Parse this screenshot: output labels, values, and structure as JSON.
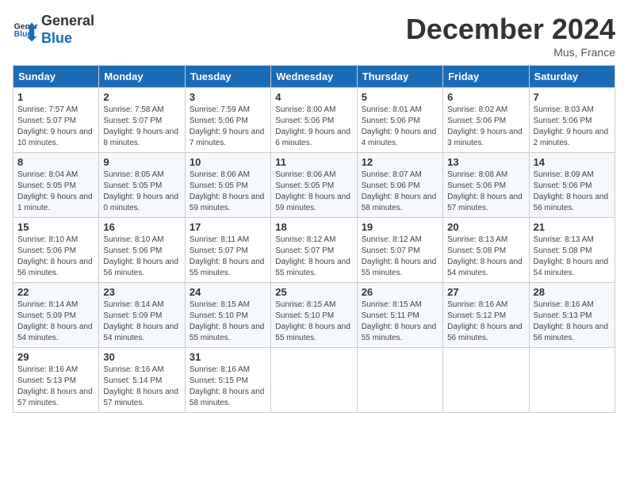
{
  "logo": {
    "line1": "General",
    "line2": "Blue"
  },
  "title": "December 2024",
  "subtitle": "Mus, France",
  "days_header": [
    "Sunday",
    "Monday",
    "Tuesday",
    "Wednesday",
    "Thursday",
    "Friday",
    "Saturday"
  ],
  "weeks": [
    [
      {
        "day": "1",
        "sunrise": "7:57 AM",
        "sunset": "5:07 PM",
        "daylight": "9 hours and 10 minutes."
      },
      {
        "day": "2",
        "sunrise": "7:58 AM",
        "sunset": "5:07 PM",
        "daylight": "9 hours and 8 minutes."
      },
      {
        "day": "3",
        "sunrise": "7:59 AM",
        "sunset": "5:06 PM",
        "daylight": "9 hours and 7 minutes."
      },
      {
        "day": "4",
        "sunrise": "8:00 AM",
        "sunset": "5:06 PM",
        "daylight": "9 hours and 6 minutes."
      },
      {
        "day": "5",
        "sunrise": "8:01 AM",
        "sunset": "5:06 PM",
        "daylight": "9 hours and 4 minutes."
      },
      {
        "day": "6",
        "sunrise": "8:02 AM",
        "sunset": "5:06 PM",
        "daylight": "9 hours and 3 minutes."
      },
      {
        "day": "7",
        "sunrise": "8:03 AM",
        "sunset": "5:06 PM",
        "daylight": "9 hours and 2 minutes."
      }
    ],
    [
      {
        "day": "8",
        "sunrise": "8:04 AM",
        "sunset": "5:05 PM",
        "daylight": "9 hours and 1 minute."
      },
      {
        "day": "9",
        "sunrise": "8:05 AM",
        "sunset": "5:05 PM",
        "daylight": "9 hours and 0 minutes."
      },
      {
        "day": "10",
        "sunrise": "8:06 AM",
        "sunset": "5:05 PM",
        "daylight": "8 hours and 59 minutes."
      },
      {
        "day": "11",
        "sunrise": "8:06 AM",
        "sunset": "5:05 PM",
        "daylight": "8 hours and 59 minutes."
      },
      {
        "day": "12",
        "sunrise": "8:07 AM",
        "sunset": "5:06 PM",
        "daylight": "8 hours and 58 minutes."
      },
      {
        "day": "13",
        "sunrise": "8:08 AM",
        "sunset": "5:06 PM",
        "daylight": "8 hours and 57 minutes."
      },
      {
        "day": "14",
        "sunrise": "8:09 AM",
        "sunset": "5:06 PM",
        "daylight": "8 hours and 56 minutes."
      }
    ],
    [
      {
        "day": "15",
        "sunrise": "8:10 AM",
        "sunset": "5:06 PM",
        "daylight": "8 hours and 56 minutes."
      },
      {
        "day": "16",
        "sunrise": "8:10 AM",
        "sunset": "5:06 PM",
        "daylight": "8 hours and 56 minutes."
      },
      {
        "day": "17",
        "sunrise": "8:11 AM",
        "sunset": "5:07 PM",
        "daylight": "8 hours and 55 minutes."
      },
      {
        "day": "18",
        "sunrise": "8:12 AM",
        "sunset": "5:07 PM",
        "daylight": "8 hours and 55 minutes."
      },
      {
        "day": "19",
        "sunrise": "8:12 AM",
        "sunset": "5:07 PM",
        "daylight": "8 hours and 55 minutes."
      },
      {
        "day": "20",
        "sunrise": "8:13 AM",
        "sunset": "5:08 PM",
        "daylight": "8 hours and 54 minutes."
      },
      {
        "day": "21",
        "sunrise": "8:13 AM",
        "sunset": "5:08 PM",
        "daylight": "8 hours and 54 minutes."
      }
    ],
    [
      {
        "day": "22",
        "sunrise": "8:14 AM",
        "sunset": "5:09 PM",
        "daylight": "8 hours and 54 minutes."
      },
      {
        "day": "23",
        "sunrise": "8:14 AM",
        "sunset": "5:09 PM",
        "daylight": "8 hours and 54 minutes."
      },
      {
        "day": "24",
        "sunrise": "8:15 AM",
        "sunset": "5:10 PM",
        "daylight": "8 hours and 55 minutes."
      },
      {
        "day": "25",
        "sunrise": "8:15 AM",
        "sunset": "5:10 PM",
        "daylight": "8 hours and 55 minutes."
      },
      {
        "day": "26",
        "sunrise": "8:15 AM",
        "sunset": "5:11 PM",
        "daylight": "8 hours and 55 minutes."
      },
      {
        "day": "27",
        "sunrise": "8:16 AM",
        "sunset": "5:12 PM",
        "daylight": "8 hours and 56 minutes."
      },
      {
        "day": "28",
        "sunrise": "8:16 AM",
        "sunset": "5:13 PM",
        "daylight": "8 hours and 56 minutes."
      }
    ],
    [
      {
        "day": "29",
        "sunrise": "8:16 AM",
        "sunset": "5:13 PM",
        "daylight": "8 hours and 57 minutes."
      },
      {
        "day": "30",
        "sunrise": "8:16 AM",
        "sunset": "5:14 PM",
        "daylight": "8 hours and 57 minutes."
      },
      {
        "day": "31",
        "sunrise": "8:16 AM",
        "sunset": "5:15 PM",
        "daylight": "8 hours and 58 minutes."
      },
      null,
      null,
      null,
      null
    ]
  ]
}
